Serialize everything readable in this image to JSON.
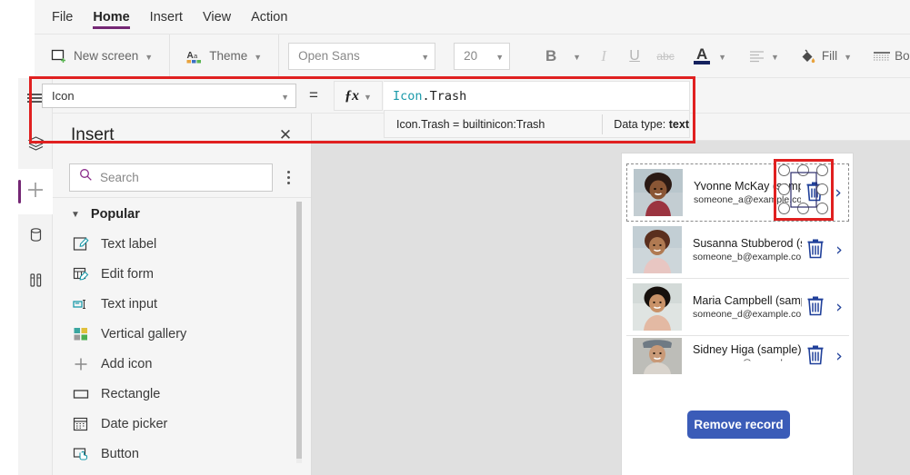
{
  "menu": {
    "items": [
      {
        "label": "File",
        "active": false
      },
      {
        "label": "Home",
        "active": true
      },
      {
        "label": "Insert",
        "active": false
      },
      {
        "label": "View",
        "active": false
      },
      {
        "label": "Action",
        "active": false
      }
    ]
  },
  "ribbon": {
    "new_screen": "New screen",
    "theme": "Theme",
    "font_family": "Open Sans",
    "font_size": "20",
    "bold": "B",
    "italic": "I",
    "underline": "U",
    "strikethrough": "abc",
    "font_color": "A",
    "align": "align",
    "fill": "Fill",
    "border": "Border"
  },
  "formula_bar": {
    "property": "Icon",
    "equals": "=",
    "fx": "fx",
    "formula_keyword": "Icon",
    "formula_rest": ".Trash",
    "tooltip_expression": "Icon.Trash  =  builtinicon:Trash",
    "tooltip_datatype_label": "Data type:",
    "tooltip_datatype_value": "text"
  },
  "rail": {
    "items": [
      {
        "name": "tree-view-icon",
        "label": "Tree view",
        "active": false
      },
      {
        "name": "screens-icon",
        "label": "Screens",
        "active": false
      },
      {
        "name": "insert-icon",
        "label": "Insert",
        "active": true
      },
      {
        "name": "data-icon",
        "label": "Data",
        "active": false
      },
      {
        "name": "media-icon",
        "label": "Media",
        "active": false
      }
    ]
  },
  "insert_panel": {
    "title": "Insert",
    "close": "✕",
    "search_placeholder": "Search",
    "group_label": "Popular",
    "items": [
      {
        "label": "Text label",
        "icon": "text-label-icon"
      },
      {
        "label": "Edit form",
        "icon": "edit-form-icon"
      },
      {
        "label": "Text input",
        "icon": "text-input-icon"
      },
      {
        "label": "Vertical gallery",
        "icon": "vertical-gallery-icon"
      },
      {
        "label": "Add icon",
        "icon": "add-icon"
      },
      {
        "label": "Rectangle",
        "icon": "rectangle-icon"
      },
      {
        "label": "Date picker",
        "icon": "date-picker-icon"
      },
      {
        "label": "Button",
        "icon": "button-icon"
      }
    ]
  },
  "canvas": {
    "gallery": {
      "rows": [
        {
          "name": "Yvonne McKay (sample)",
          "email": "someone_a@example.com",
          "selected": true,
          "clipped": false
        },
        {
          "name": "Susanna Stubberod (sample)",
          "email": "someone_b@example.com",
          "selected": false,
          "clipped": false
        },
        {
          "name": "Maria Campbell (sample)",
          "email": "someone_d@example.com",
          "selected": false,
          "clipped": false
        },
        {
          "name": "Sidney Higa (sample)",
          "email": "someone_c@example.com",
          "selected": false,
          "clipped": true
        }
      ]
    },
    "remove_button": "Remove record"
  },
  "colors": {
    "accent_purple": "#742774",
    "highlight_red": "#e02020",
    "button_blue": "#3b5cb8",
    "icon_navy": "#20409a",
    "formula_keyword": "#1b9aaa"
  }
}
